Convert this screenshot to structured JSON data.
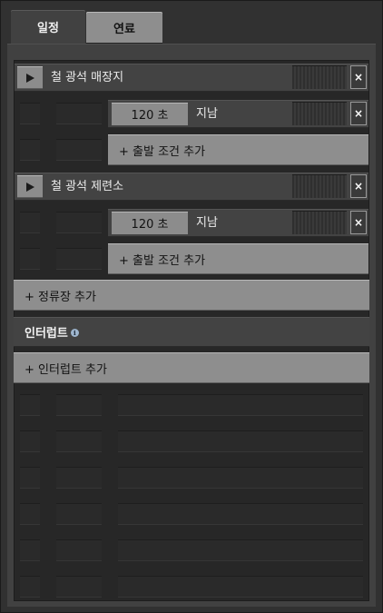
{
  "tabs": [
    {
      "label": "일정",
      "active": true
    },
    {
      "label": "연료",
      "active": false
    }
  ],
  "stations": [
    {
      "name": "철 광석 매장지",
      "conditions": [
        {
          "time": "120 초",
          "label": "지남"
        }
      ],
      "add_condition_label": "+ 출발 조건 추가"
    },
    {
      "name": "철 광석 제련소",
      "conditions": [
        {
          "time": "120 초",
          "label": "지남"
        }
      ],
      "add_condition_label": "+ 출발 조건 추가"
    }
  ],
  "add_station_label": "+ 정류장 추가",
  "interrupts_header": "인터럽트",
  "add_interrupt_label": "+ 인터럽트 추가",
  "icons": {
    "play": "play-icon",
    "close": "close-icon",
    "info": "info-icon"
  },
  "close_glyph": "×",
  "info_glyph": "i",
  "colors": {
    "panel_bg": "#414141",
    "button_gray": "#8e8e8e",
    "list_bg": "#272727",
    "info_blue": "#9fb6cf"
  }
}
